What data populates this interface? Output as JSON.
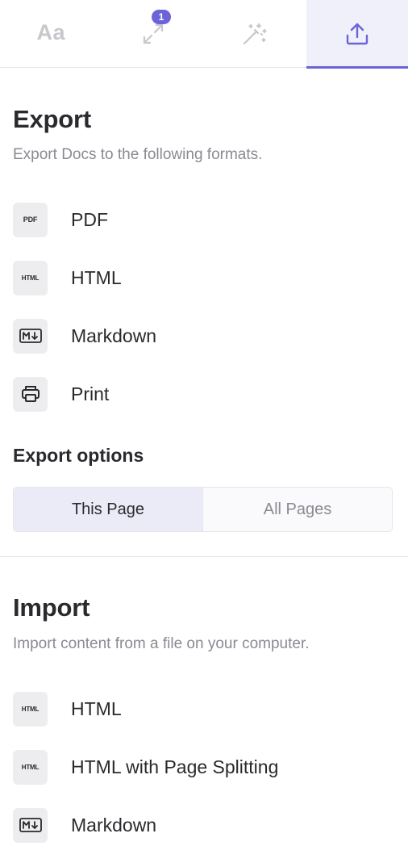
{
  "tabs": [
    {
      "name": "typography",
      "icon": "text-style-icon",
      "label": "Aa"
    },
    {
      "name": "layout",
      "icon": "resize-arrows-icon",
      "badge": "1"
    },
    {
      "name": "magic",
      "icon": "magic-wand-icon"
    },
    {
      "name": "export",
      "icon": "upload-icon",
      "active": true
    }
  ],
  "export": {
    "title": "Export",
    "subtitle": "Export Docs to the following formats.",
    "items": [
      {
        "icon_text": "PDF",
        "label": "PDF"
      },
      {
        "icon_text": "HTML",
        "label": "HTML"
      },
      {
        "icon": "markdown-icon",
        "label": "Markdown"
      },
      {
        "icon": "printer-icon",
        "label": "Print"
      }
    ],
    "options_title": "Export options",
    "options": [
      "This Page",
      "All Pages"
    ],
    "selected_option": "This Page"
  },
  "import": {
    "title": "Import",
    "subtitle": "Import content from a file on your computer.",
    "items": [
      {
        "icon_text": "HTML",
        "label": "HTML"
      },
      {
        "icon_text": "HTML",
        "label": "HTML with Page Splitting"
      },
      {
        "icon": "markdown-icon",
        "label": "Markdown"
      }
    ]
  },
  "colors": {
    "accent": "#6c63d9",
    "text": "#2a2a2e",
    "muted": "#8a8a92",
    "icon_bg": "#ededef"
  }
}
